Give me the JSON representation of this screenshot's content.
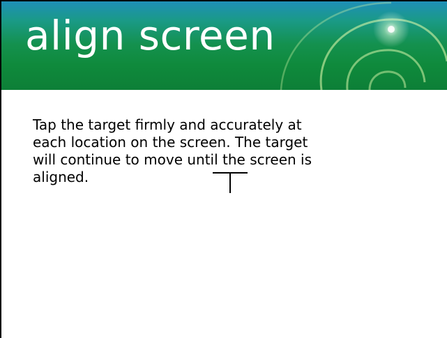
{
  "header": {
    "title": "align screen"
  },
  "main": {
    "instructions": "Tap the target firmly and accurately at each location on the screen. The target will continue to move until the screen is aligned."
  },
  "colors": {
    "header_top": "#1f8fb8",
    "header_mid": "#14914f",
    "header_bottom": "#0d7f37",
    "title_text": "#ffffff",
    "body_text": "#000000",
    "target": "#000000"
  },
  "icons": {
    "header_decoration": "swirl-icon",
    "target": "crosshair-target-icon"
  }
}
